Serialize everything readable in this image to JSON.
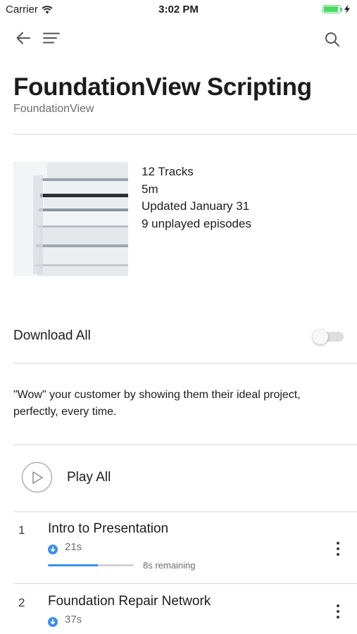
{
  "status_bar": {
    "carrier": "Carrier",
    "time": "3:02 PM",
    "battery_level": 0.9
  },
  "nav": {
    "back_icon": "arrow-left-icon",
    "menu_icon": "menu-icon",
    "search_icon": "search-icon"
  },
  "header": {
    "title": "FoundationView Scripting",
    "author": "FoundationView"
  },
  "meta": {
    "tracks": "12 Tracks",
    "duration": "5m",
    "updated": "Updated January 31",
    "unplayed": "9 unplayed episodes"
  },
  "download_all": {
    "label": "Download All",
    "enabled": false
  },
  "description": "\"Wow\" your customer by showing them their ideal project, perfectly, every time.",
  "play_all": {
    "label": "Play All"
  },
  "tracks": [
    {
      "number": "1",
      "title": "Intro to Presentation",
      "duration": "21s",
      "remaining": "8s remaining",
      "progress": 0.58
    },
    {
      "number": "2",
      "title": "Foundation Repair Network",
      "duration": "37s"
    }
  ],
  "colors": {
    "accent": "#3b8ef0",
    "battery": "#4cd964",
    "divider": "#d9d9dc"
  }
}
